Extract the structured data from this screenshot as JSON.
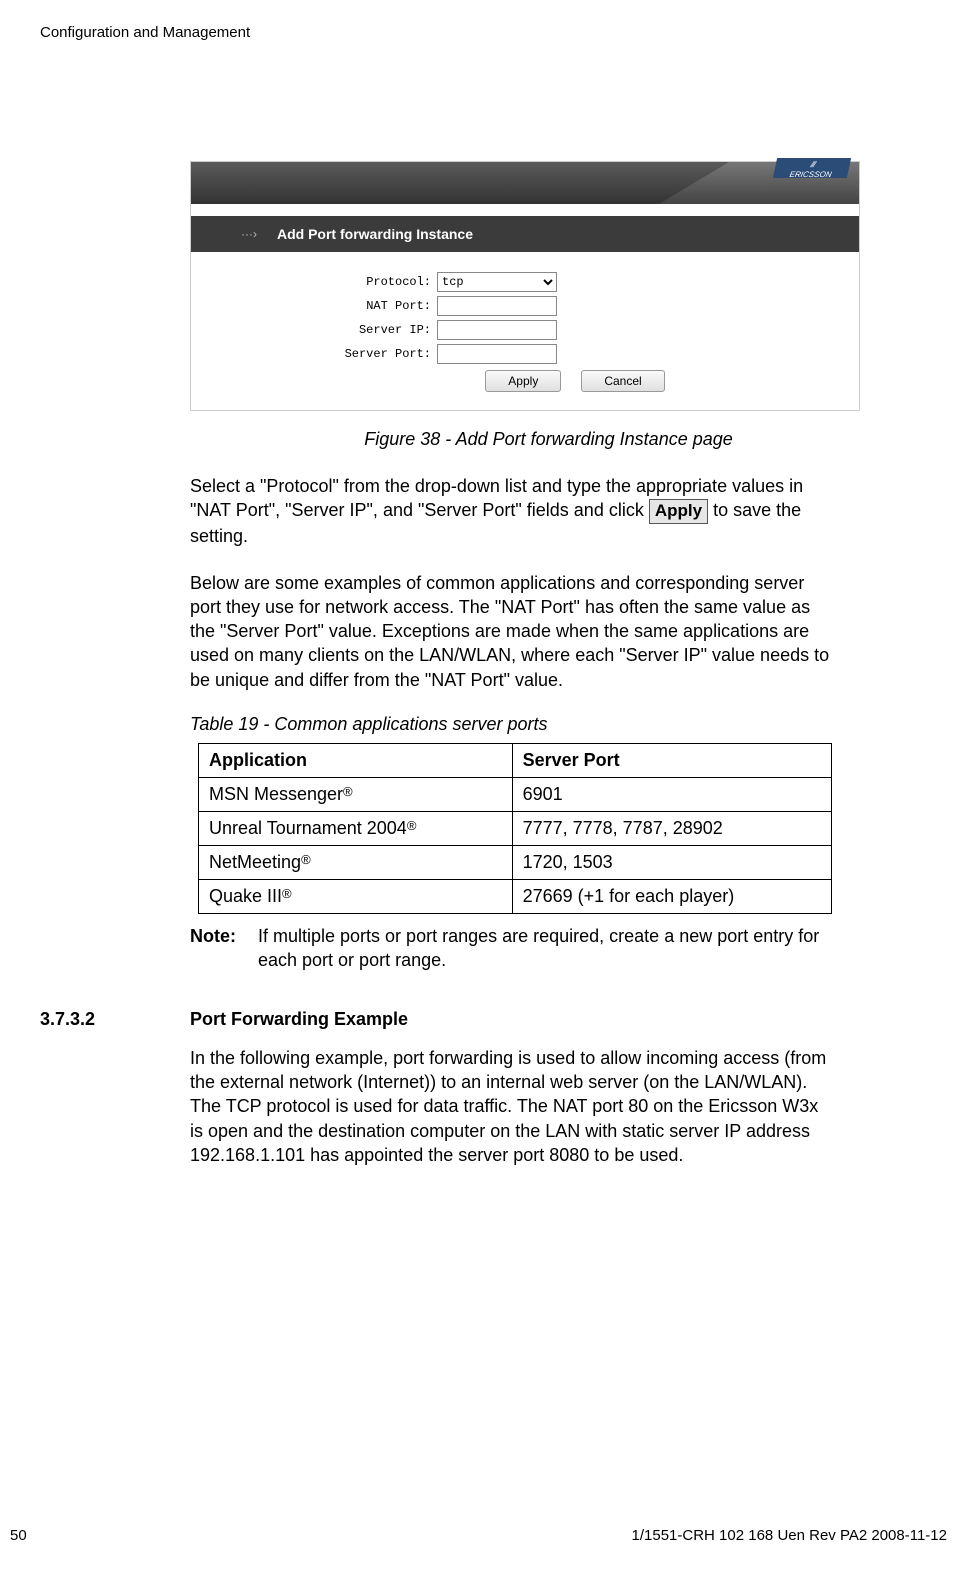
{
  "running_header": "Configuration and Management",
  "figure": {
    "brand": "ERICSSON",
    "arrow": "···›",
    "panel_title": "Add Port forwarding Instance",
    "labels": {
      "protocol": "Protocol:",
      "nat_port": "NAT Port:",
      "server_ip": "Server IP:",
      "server_port": "Server Port:"
    },
    "protocol_value": "tcp",
    "buttons": {
      "apply": "Apply",
      "cancel": "Cancel"
    },
    "caption": "Figure 38 - Add Port forwarding Instance page"
  },
  "para1_a": "Select a \"Protocol\" from the drop-down list and type the appropriate values in \"NAT Port\", \"Server IP\", and \"Server Port\" fields and click ",
  "apply_inline": "Apply",
  "para1_b": " to save the setting.",
  "para2": "Below are some examples of common applications and corresponding server port they use for network access. The \"NAT Port\" has often the same value as the \"Server Port\" value. Exceptions are made when the same applications are used on many clients on the LAN/WLAN, where each \"Server IP\" value needs to be unique and differ from the \"NAT Port\" value.",
  "table_caption": "Table 19 - Common applications server ports",
  "table": {
    "headers": {
      "app": "Application",
      "port": "Server Port"
    },
    "rows": [
      {
        "app": "MSN Messenger",
        "port": "6901"
      },
      {
        "app": "Unreal Tournament 2004",
        "port": "7777, 7778, 7787, 28902"
      },
      {
        "app": "NetMeeting",
        "port": "1720, 1503"
      },
      {
        "app": "Quake III",
        "port": "27669 (+1 for each player)"
      }
    ]
  },
  "note_label": "Note:",
  "note_text": "If multiple ports or port ranges are required, create a new port entry for each port or port range.",
  "section_num": "3.7.3.2",
  "section_title": "Port Forwarding Example",
  "para3": "In the following example, port forwarding is used to allow incoming access (from the external network (Internet)) to an internal web server (on the LAN/WLAN). The TCP protocol is used for data traffic. The NAT port 80 on the Ericsson W3x is open and the destination computer on the LAN with static server IP address 192.168.1.101 has appointed the server port 8080 to be used.",
  "footer": {
    "page": "50",
    "docref": "1/1551-CRH 102 168 Uen Rev PA2  2008-11-12"
  },
  "chart_data": {
    "type": "table",
    "title": "Table 19 - Common applications server ports",
    "columns": [
      "Application",
      "Server Port"
    ],
    "rows": [
      [
        "MSN Messenger®",
        "6901"
      ],
      [
        "Unreal Tournament 2004®",
        "7777, 7778, 7787, 28902"
      ],
      [
        "NetMeeting®",
        "1720, 1503"
      ],
      [
        "Quake III®",
        "27669 (+1 for each player)"
      ]
    ]
  }
}
